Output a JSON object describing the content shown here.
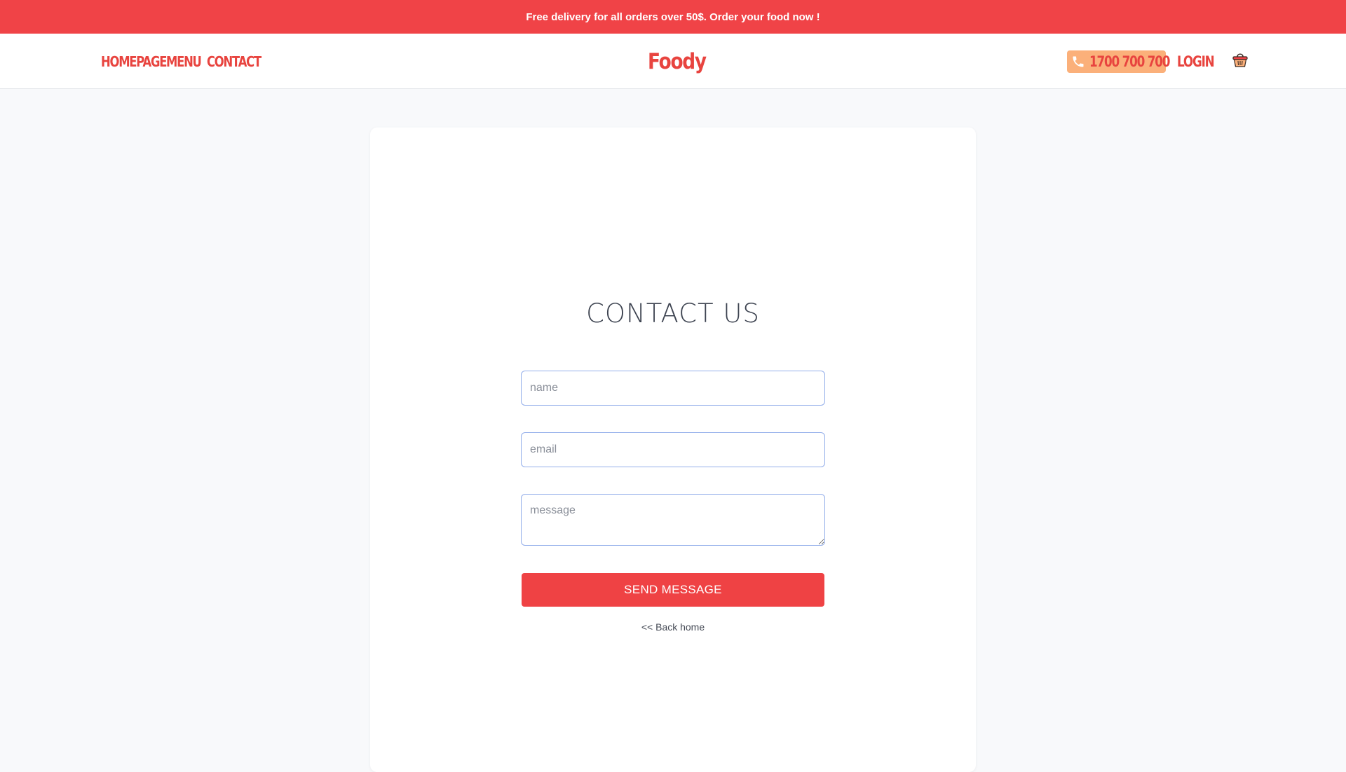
{
  "promo": {
    "text": "Free delivery for all orders over 50$. Order your food now !"
  },
  "nav": {
    "links": [
      {
        "label": "HOMEPAGE"
      },
      {
        "label": "MENU"
      },
      {
        "label": "CONTACT"
      }
    ],
    "logo": "Foody",
    "phone": "1700 700 700",
    "login": "LOGIN",
    "icons": {
      "phone": "phone-icon",
      "cart": "basket-icon"
    }
  },
  "contact": {
    "title": "CONTACT US",
    "name_placeholder": "name",
    "email_placeholder": "email",
    "message_placeholder": "message",
    "send_label": "SEND MESSAGE",
    "back_label": "<< Back home"
  },
  "colors": {
    "brand_red": "#f04347",
    "phone_badge": "#fbb07a",
    "input_border": "#93aeea",
    "page_bg": "#f8f9fb"
  }
}
